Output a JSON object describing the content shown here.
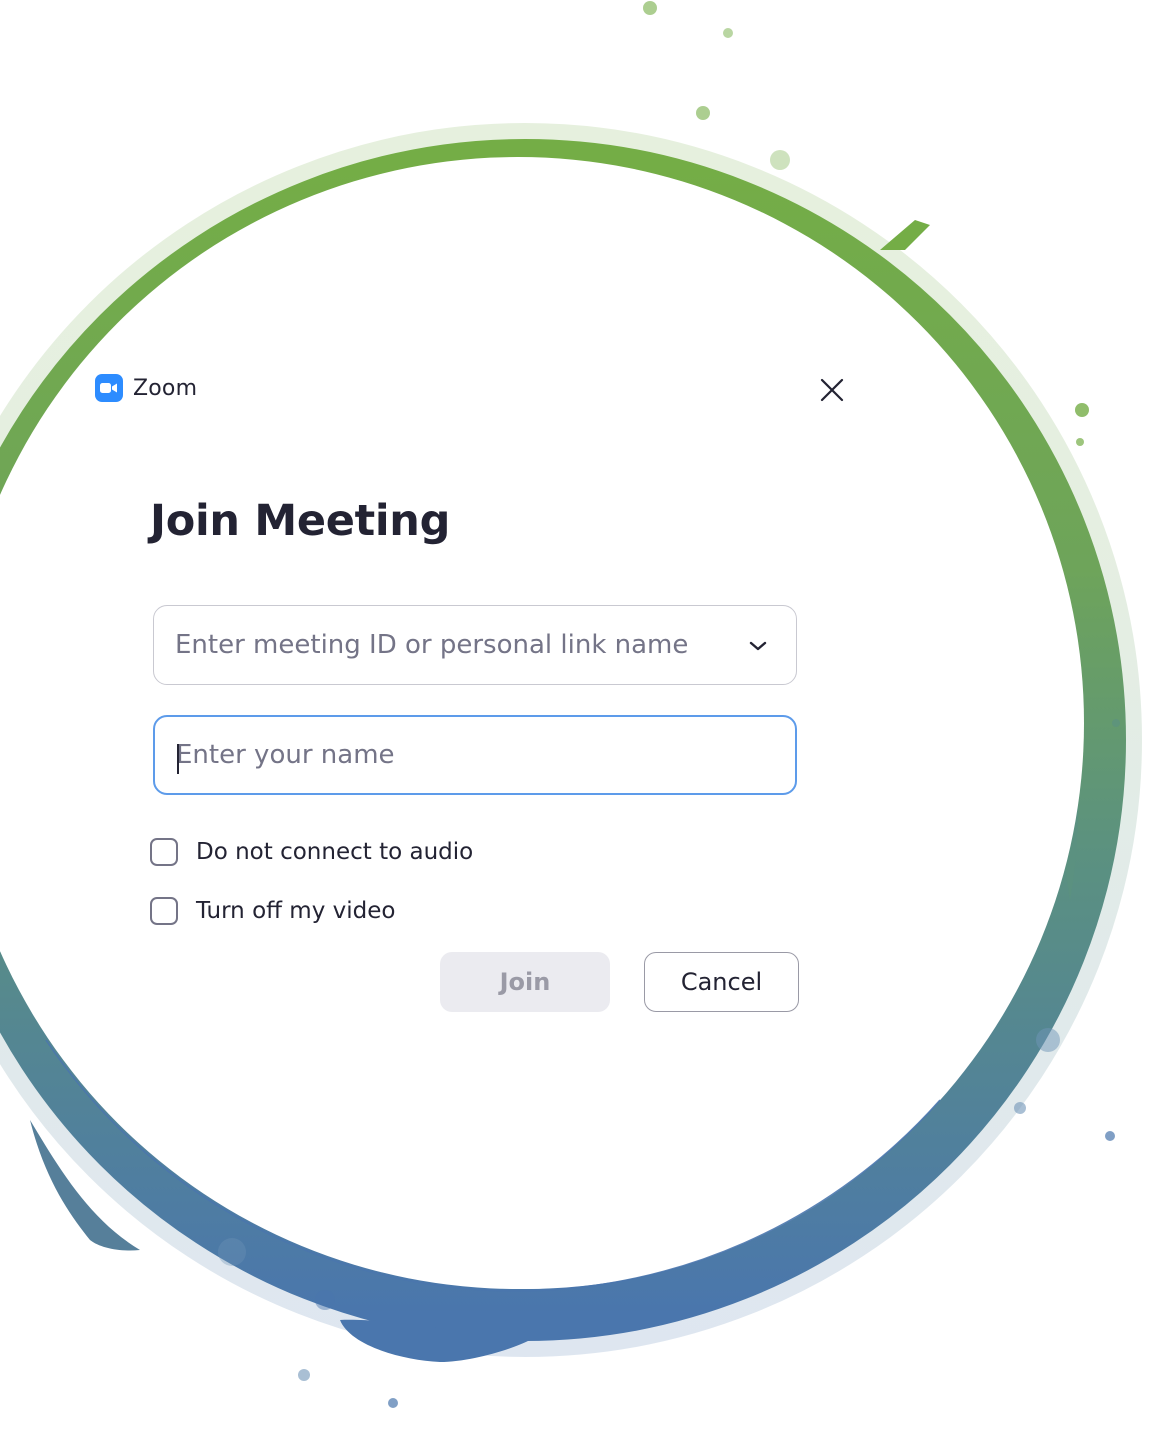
{
  "app": {
    "title": "Zoom",
    "logo_icon": "zoom-camera-icon",
    "close_icon": "close-icon"
  },
  "dialog": {
    "heading": "Join Meeting",
    "meeting_id": {
      "placeholder": "Enter meeting ID or personal link name",
      "value": "",
      "dropdown_icon": "chevron-down-icon"
    },
    "name": {
      "placeholder": "Enter your name",
      "value": "",
      "focused": true
    },
    "options": [
      {
        "label": "Do not connect to audio",
        "checked": false
      },
      {
        "label": "Turn off my video",
        "checked": false
      }
    ],
    "buttons": {
      "join_label": "Join",
      "join_enabled": false,
      "cancel_label": "Cancel"
    }
  },
  "colors": {
    "brand_blue": "#2d8cff",
    "ring_green": "#74ad46",
    "ring_blue": "#4a76ad",
    "text_dark": "#232333",
    "focus_border": "#5d9bea"
  }
}
